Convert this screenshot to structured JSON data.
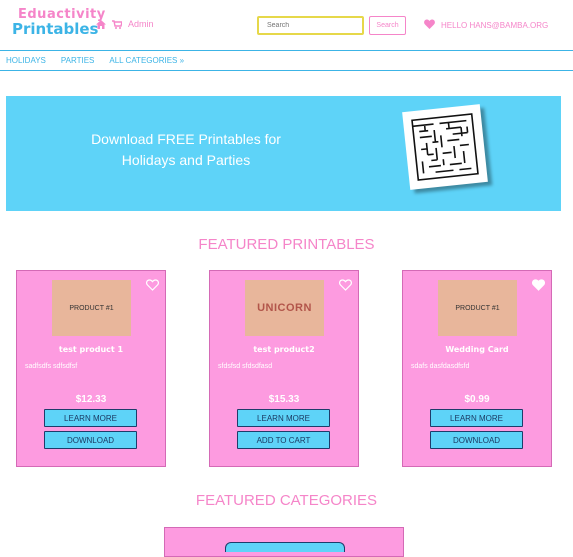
{
  "header": {
    "logo_line1": "Eduactivity",
    "logo_line2": "Printables",
    "admin_label": "Admin",
    "search_placeholder": "Search",
    "search_button": "Search",
    "hello_text": "HELLO HANS@BAMBA.ORG"
  },
  "nav": {
    "items": [
      "HOLIDAYS",
      "PARTIES",
      "ALL CATEGORIES »"
    ]
  },
  "hero": {
    "line1": "Download FREE Printables for",
    "line2": "Holidays and Parties"
  },
  "featured_printables": {
    "title": "FEATURED PRINTABLES",
    "cards": [
      {
        "thumb": "PRODUCT #1",
        "name": "test product 1",
        "desc": "sadfsdfs sdfsdfsf",
        "price": "$12.33",
        "btn1": "LEARN MORE",
        "btn2": "DOWNLOAD",
        "favorited": false
      },
      {
        "thumb": "UNICORN",
        "name": "test product2",
        "desc": "sfdsfsd sfdsdfasd",
        "price": "$15.33",
        "btn1": "LEARN MORE",
        "btn2": "ADD TO CART",
        "favorited": false
      },
      {
        "thumb": "PRODUCT #1",
        "name": "Wedding Card",
        "desc": "sdafs dasfdasdfsfd",
        "price": "$0.99",
        "btn1": "LEARN MORE",
        "btn2": "DOWNLOAD",
        "favorited": true
      }
    ]
  },
  "featured_categories": {
    "title": "FEATURED CATEGORIES"
  },
  "colors": {
    "pink": "#f585c9",
    "blue": "#3cb4e6",
    "hero_blue": "#5ed3f8",
    "card_pink": "#fd9be0",
    "thumb_tan": "#e8b69b"
  },
  "icons": [
    "home-icon",
    "cart-icon",
    "heart-icon",
    "maze-icon"
  ]
}
